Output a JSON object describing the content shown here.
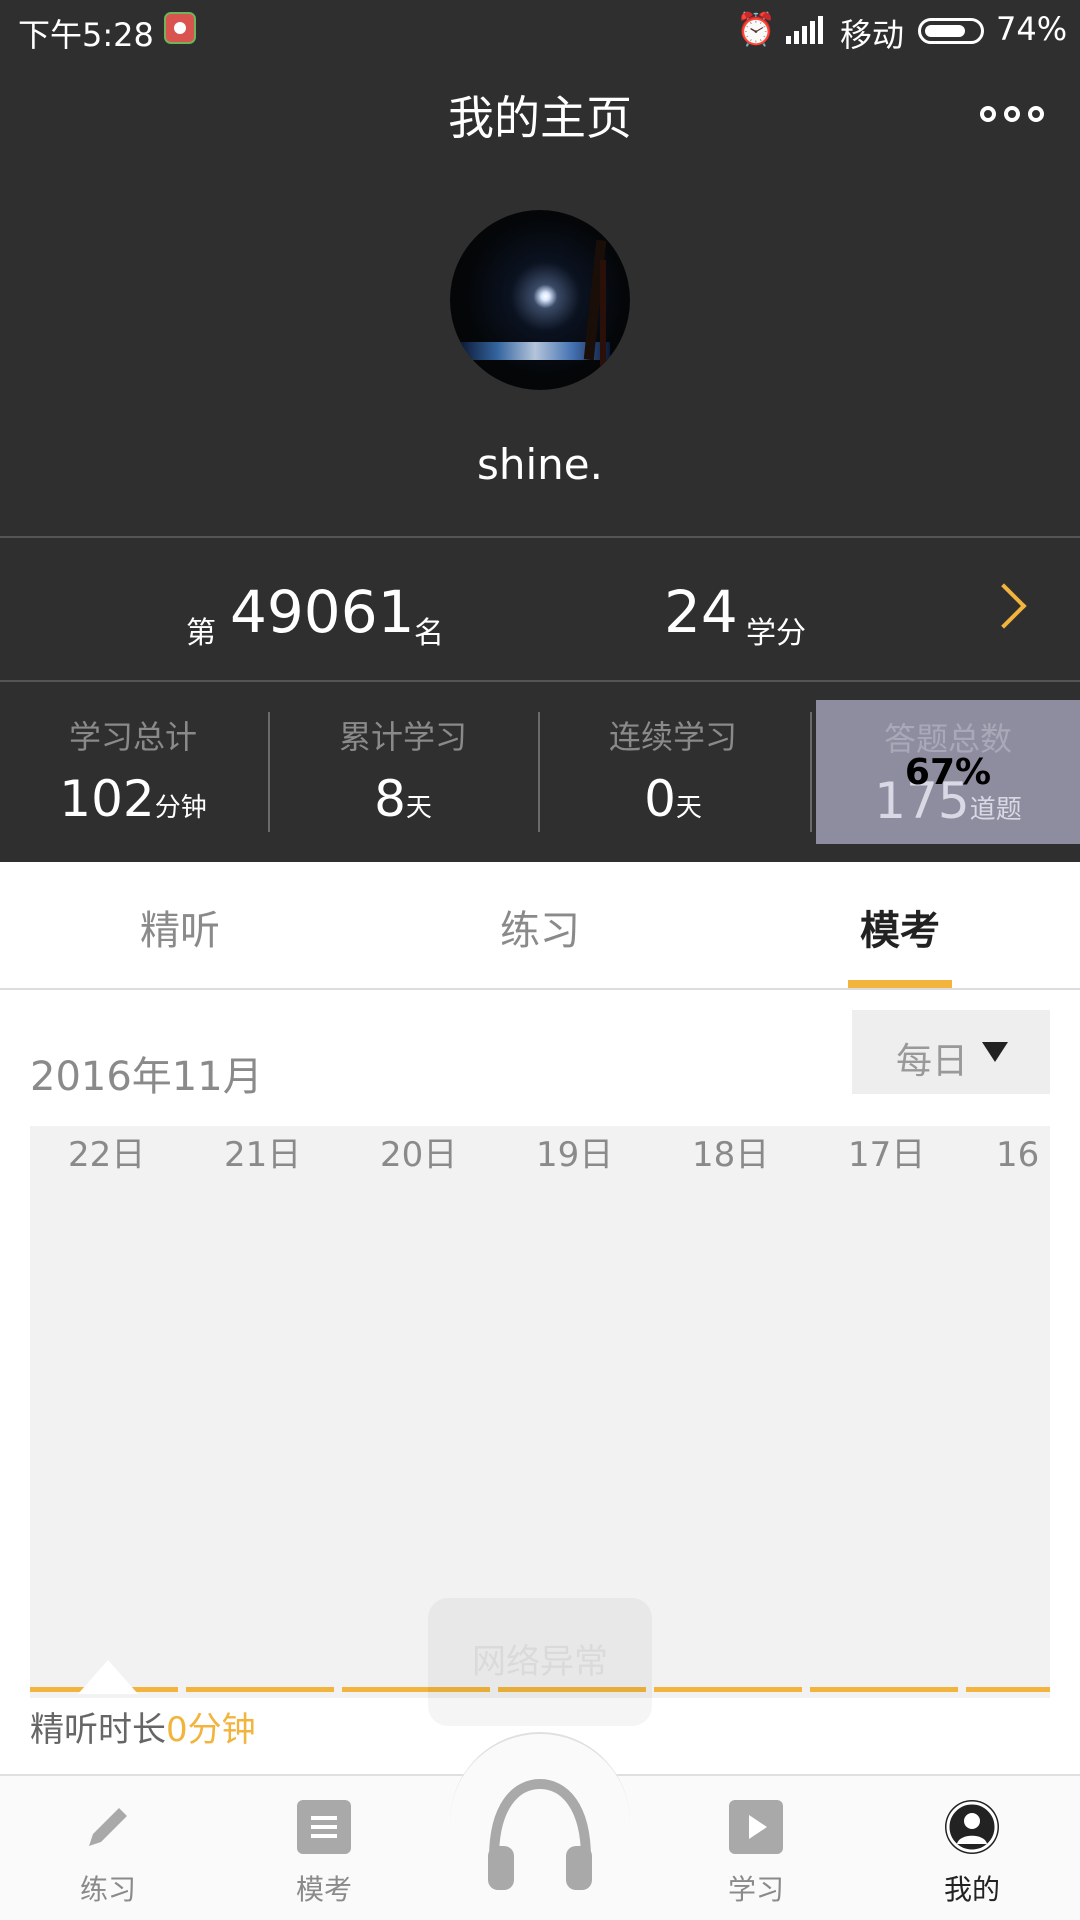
{
  "status_bar": {
    "time": "下午5:28",
    "carrier": "移动",
    "battery_percent": "74%",
    "battery_level": 0.74,
    "icons": [
      "app-notification-icon",
      "alarm-icon",
      "signal-icon",
      "battery-icon"
    ]
  },
  "header": {
    "title": "我的主页",
    "more_icon": "more-dots-icon",
    "username": "shine."
  },
  "ranking": {
    "prefix": "第",
    "rank": "49061",
    "suffix": "名",
    "credits": "24",
    "credits_unit": "学分"
  },
  "stats": [
    {
      "label": "学习总计",
      "value": "102",
      "unit": "分钟"
    },
    {
      "label": "累计学习",
      "value": "8",
      "unit": "天"
    },
    {
      "label": "连续学习",
      "value": "0",
      "unit": "天"
    },
    {
      "label": "答题总数",
      "value": "175",
      "unit": "道题",
      "progress": "67%"
    }
  ],
  "tabs": [
    {
      "label": "精听",
      "active": false
    },
    {
      "label": "练习",
      "active": false
    },
    {
      "label": "模考",
      "active": true
    }
  ],
  "chart_header": {
    "month": "2016年11月",
    "period_select": "每日"
  },
  "chart_data": {
    "type": "bar",
    "categories": [
      "22日",
      "21日",
      "20日",
      "19日",
      "18日",
      "17日",
      "16"
    ],
    "values": [
      0,
      0,
      0,
      0,
      0,
      0,
      0
    ],
    "bar_color": "#f2b43c",
    "background_color": "#f2f2f2"
  },
  "chart_footer": {
    "label": "精听时长",
    "value": "0分钟"
  },
  "toast": "网络异常",
  "bottom_nav": [
    {
      "label": "练习",
      "icon": "pencil-icon",
      "active": false
    },
    {
      "label": "模考",
      "icon": "document-icon",
      "active": false
    },
    {
      "label": "",
      "icon": "headphones-icon",
      "active": false
    },
    {
      "label": "学习",
      "icon": "play-icon",
      "active": false
    },
    {
      "label": "我的",
      "icon": "profile-icon",
      "active": true
    }
  ],
  "colors": {
    "header_bg": "#2f2f2f",
    "accent": "#f2b43c",
    "highlight_cell": "#8e8d9f"
  }
}
